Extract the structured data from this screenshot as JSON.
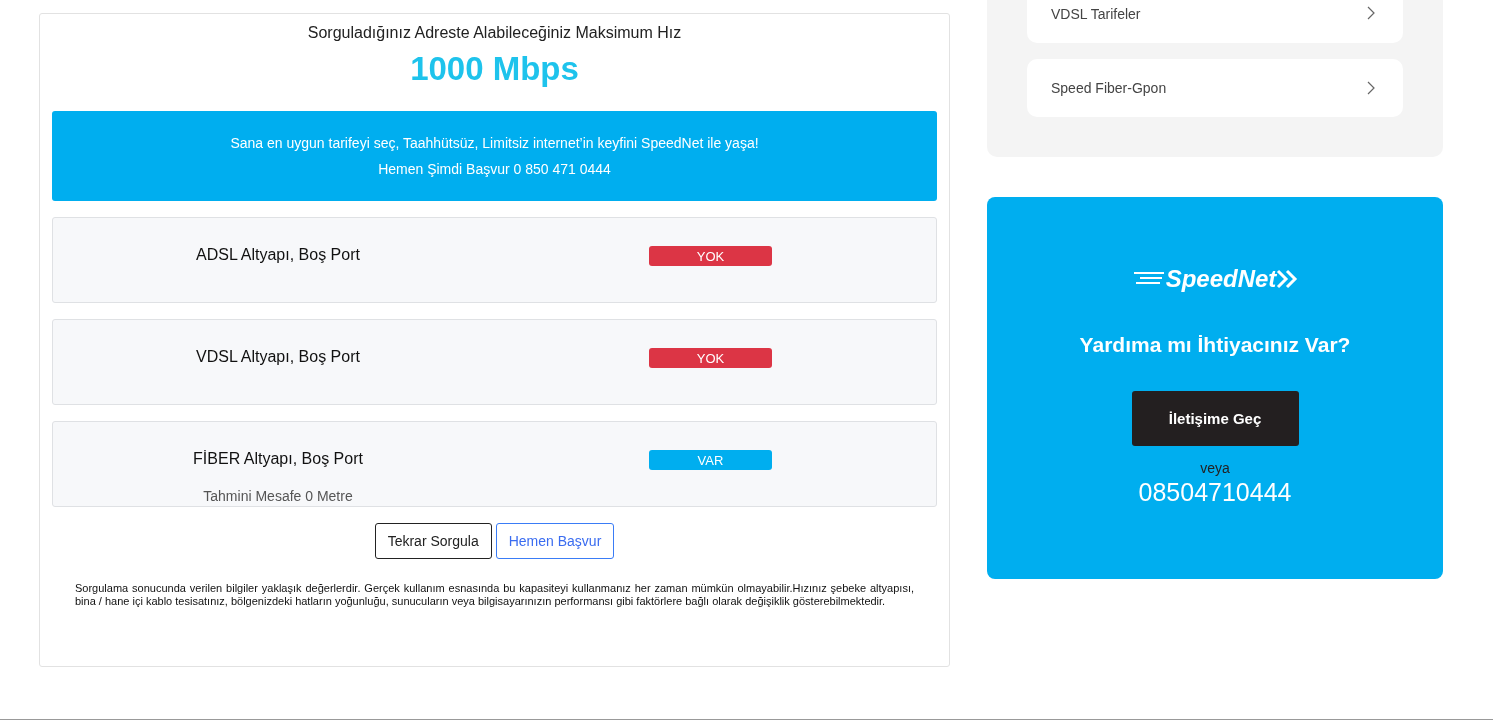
{
  "result": {
    "heading": "Sorguladığınız Adreste Alabileceğiniz Maksimum Hız",
    "speed": "1000 Mbps",
    "banner": [
      "Sana en uygun tarifeyi seç, Taahhütsüz, Limitsiz internet’in keyfini SpeedNet ile yaşa!",
      "Hemen Şimdi Başvur 0 850 471 0444"
    ],
    "infrastructure": [
      {
        "name": "ADSL Altyapı, Boş Port",
        "status": "YOK",
        "available": false
      },
      {
        "name": "VDSL Altyapı, Boş Port",
        "status": "YOK",
        "available": false
      },
      {
        "name": "FİBER Altyapı, Boş Port",
        "status": "VAR",
        "available": true,
        "distance": "Tahmini Mesafe 0 Metre"
      }
    ],
    "buttons": [
      {
        "label": "Tekrar Sorgula",
        "kind": "secondary"
      },
      {
        "label": "Hemen Başvur",
        "kind": "primary"
      }
    ],
    "disclaimer": "Sorgulama sonucunda verilen bilgiler yaklaşık değerlerdir. Gerçek kullanım esnasında bu kapasiteyi kullanmanız her zaman mümkün olmayabilir.Hızınız şebeke altyapısı, bina / hane içi kablo tesisatınız, bölgenizdeki hatların yoğunluğu, sunucuların veya bilgisayarınızın performansı gibi faktörlere bağlı olarak değişiklik gösterebilmektedir."
  },
  "sidebar": {
    "items": [
      {
        "label": "VDSL Tarifeler"
      },
      {
        "label": "Speed Fiber-Gpon"
      }
    ]
  },
  "help": {
    "logo": "SpeedNet",
    "title": "Yardıma mı İhtiyacınız Var?",
    "button": "İletişime Geç",
    "or": "veya",
    "phone": "08504710444"
  }
}
